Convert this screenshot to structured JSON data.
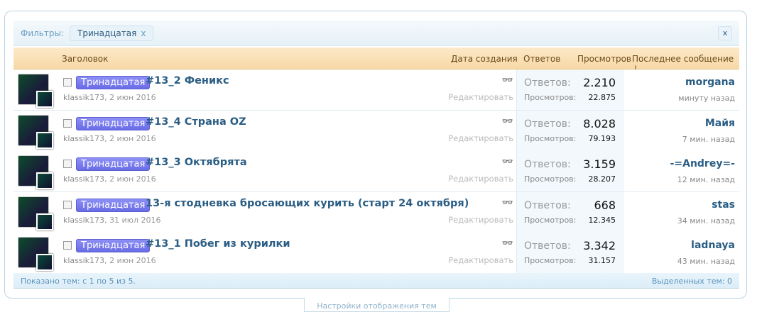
{
  "filters": {
    "label": "Фильтры:",
    "chip": "Тринадцатая",
    "chip_remove": "x",
    "close": "x"
  },
  "header": {
    "title": "Заголовок",
    "date": "Дата создания",
    "replies": "Ответов",
    "views": "Просмотров",
    "last": "Последнее сообщение ↓"
  },
  "row_labels": {
    "replies": "Ответов:",
    "views": "Просмотров:",
    "edit": "Редактировать",
    "glasses": "👓"
  },
  "threads": [
    {
      "prefix": "Тринадцатая",
      "title": "#13_2 Феникс",
      "author": "klassik173",
      "date": "2 июн 2016",
      "replies": "2.210",
      "views": "22.875",
      "last_user": "morgana",
      "last_time": "минуту назад"
    },
    {
      "prefix": "Тринадцатая",
      "title": "#13_4 Страна OZ",
      "author": "klassik173",
      "date": "2 июн 2016",
      "replies": "8.028",
      "views": "79.193",
      "last_user": "Майя",
      "last_time": "7 мин. назад"
    },
    {
      "prefix": "Тринадцатая",
      "title": "#13_3 Октябрята",
      "author": "klassik173",
      "date": "2 июн 2016",
      "replies": "3.159",
      "views": "28.207",
      "last_user": "-=Andrey=-",
      "last_time": "12 мин. назад"
    },
    {
      "prefix": "Тринадцатая",
      "title": "13-я стодневка бросающих курить (старт 24 октября)",
      "author": "klassik173",
      "date": "31 июл 2016",
      "replies": "668",
      "views": "12.345",
      "last_user": "stas",
      "last_time": "34 мин. назад"
    },
    {
      "prefix": "Тринадцатая",
      "title": "#13_1 Побег из курилки",
      "author": "klassik173",
      "date": "2 июн 2016",
      "replies": "3.342",
      "views": "31.157",
      "last_user": "ladnaya",
      "last_time": "43 мин. назад"
    }
  ],
  "footer": {
    "shown": "Показано тем: с 1 по 5 из 5.",
    "selected": "Выделенных тем: 0"
  },
  "settings_tab": "Настройки отображения тем"
}
